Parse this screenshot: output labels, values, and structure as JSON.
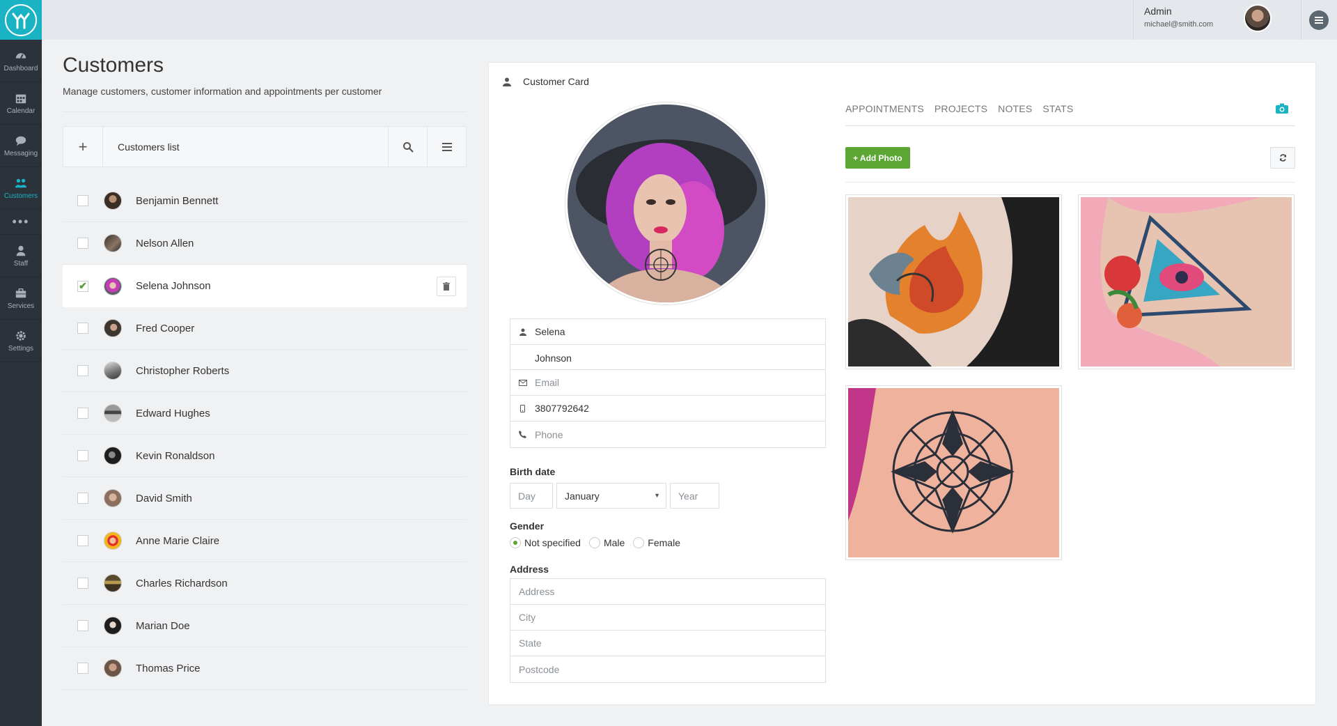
{
  "sidebar": {
    "logo_icon": "brand-logo-icon",
    "items": [
      {
        "label": "Dashboard",
        "icon": "dashboard-icon"
      },
      {
        "label": "Calendar",
        "icon": "calendar-icon"
      },
      {
        "label": "Messaging",
        "icon": "chat-icon"
      },
      {
        "label": "Customers",
        "icon": "users-icon",
        "active": true
      },
      {
        "label": "Staff",
        "icon": "user-icon"
      },
      {
        "label": "Services",
        "icon": "briefcase-icon"
      },
      {
        "label": "Settings",
        "icon": "gear-icon"
      }
    ],
    "more_label": "•••"
  },
  "topbar": {
    "user_name": "Admin",
    "user_email": "michael@smith.com"
  },
  "page": {
    "title": "Customers",
    "subtitle": "Manage customers, customer information and appointments per customer"
  },
  "list": {
    "add_label": "+",
    "title": "Customers list",
    "customers": [
      {
        "name": "Benjamin Bennett",
        "checked": false
      },
      {
        "name": "Nelson Allen",
        "checked": false
      },
      {
        "name": "Selena Johnson",
        "checked": true
      },
      {
        "name": "Fred Cooper",
        "checked": false
      },
      {
        "name": "Christopher Roberts",
        "checked": false
      },
      {
        "name": "Edward Hughes",
        "checked": false
      },
      {
        "name": "Kevin Ronaldson",
        "checked": false
      },
      {
        "name": "David Smith",
        "checked": false
      },
      {
        "name": "Anne Marie Claire",
        "checked": false
      },
      {
        "name": "Charles Richardson",
        "checked": false
      },
      {
        "name": "Marian Doe",
        "checked": false
      },
      {
        "name": "Thomas Price",
        "checked": false
      }
    ]
  },
  "card": {
    "title": "Customer Card",
    "first_name": "Selena",
    "last_name": "Johnson",
    "email_placeholder": "Email",
    "mobile": "3807792642",
    "phone_placeholder": "Phone",
    "birth_label": "Birth date",
    "day_placeholder": "Day",
    "month_value": "January",
    "year_placeholder": "Year",
    "gender_label": "Gender",
    "gender_options": [
      "Not specified",
      "Male",
      "Female"
    ],
    "gender_selected": "Not specified",
    "address_label": "Address",
    "address_placeholder": "Address",
    "city_placeholder": "City",
    "state_placeholder": "State",
    "postcode_placeholder": "Postcode",
    "tabs": [
      "APPOINTMENTS",
      "PROJECTS",
      "NOTES",
      "STATS"
    ],
    "add_photo_label": "+ Add Photo"
  },
  "colors": {
    "brand": "#1ab3c4",
    "sidebar": "#2b323a",
    "green": "#5ca734"
  }
}
